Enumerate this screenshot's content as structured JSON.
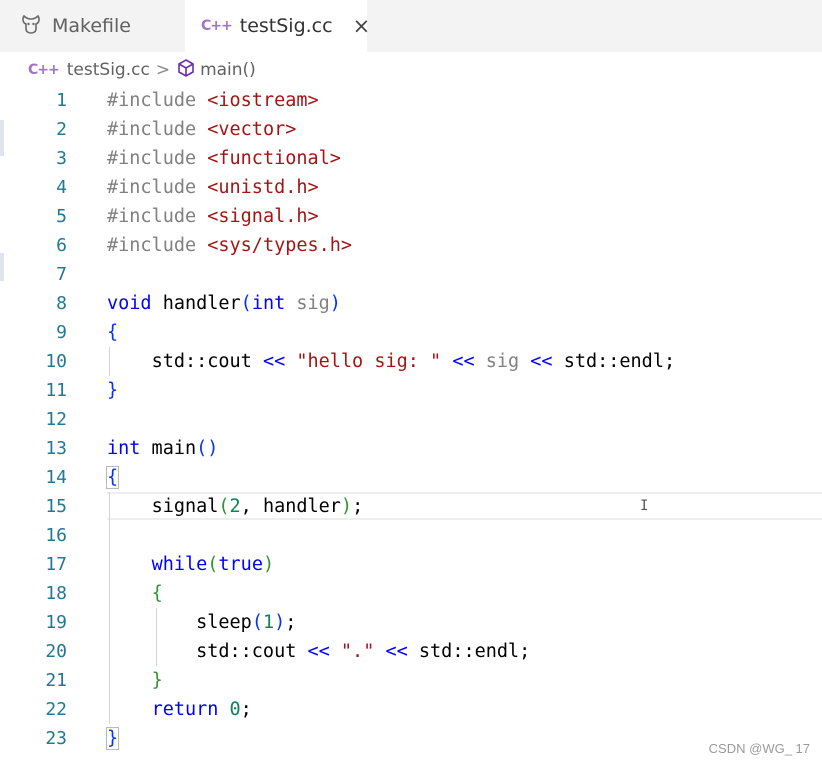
{
  "tabs": [
    {
      "label": "Makefile",
      "icon": "gnu-makefile-icon",
      "active": false
    },
    {
      "label": "testSig.cc",
      "icon": "cpp-file-icon",
      "active": true
    }
  ],
  "tab_icon_text": "C++",
  "close_glyph": "×",
  "breadcrumb": {
    "file": "testSig.cc",
    "separator": ">",
    "symbol": "main()"
  },
  "line_numbers": [
    "1",
    "2",
    "3",
    "4",
    "5",
    "6",
    "7",
    "8",
    "9",
    "10",
    "11",
    "12",
    "13",
    "14",
    "15",
    "16",
    "17",
    "18",
    "19",
    "20",
    "21",
    "22",
    "23"
  ],
  "code": {
    "l1_pre": "#include ",
    "l1_hdr": "<iostream>",
    "l2_pre": "#include ",
    "l2_hdr": "<vector>",
    "l3_pre": "#include ",
    "l3_hdr": "<functional>",
    "l4_pre": "#include ",
    "l4_hdr": "<unistd.h>",
    "l5_pre": "#include ",
    "l5_hdr": "<signal.h>",
    "l6_pre": "#include ",
    "l6_hdr": "<sys/types.h>",
    "l8_void": "void",
    "l8_name": " handler",
    "l8_open": "(",
    "l8_int": "int",
    "l8_param": " sig",
    "l8_close": ")",
    "l9_brace": "{",
    "l10_indent": "    ",
    "l10_a": "std::cout ",
    "l10_op1": "<<",
    "l10_str": " \"hello sig: \" ",
    "l10_op2": "<<",
    "l10_sig": " sig ",
    "l10_op3": "<<",
    "l10_b": " std::endl;",
    "l11_brace": "}",
    "l13_int": "int",
    "l13_name": " main",
    "l13_parens": "()",
    "l14_brace": "{",
    "l15_indent": "    ",
    "l15_a": "signal",
    "l15_open": "(",
    "l15_num": "2",
    "l15_b": ", handler",
    "l15_close": ")",
    "l15_semi": ";",
    "l17_indent": "    ",
    "l17_while": "while",
    "l17_open": "(",
    "l17_true": "true",
    "l17_close": ")",
    "l18_indent": "    ",
    "l18_brace": "{",
    "l19_indent": "        ",
    "l19_a": "sleep",
    "l19_open": "(",
    "l19_num": "1",
    "l19_close": ")",
    "l19_semi": ";",
    "l20_indent": "        ",
    "l20_a": "std::cout ",
    "l20_op1": "<<",
    "l20_str": " \".\" ",
    "l20_op2": "<<",
    "l20_b": " std::endl;",
    "l21_indent": "    ",
    "l21_brace": "}",
    "l22_indent": "    ",
    "l22_return": "return",
    "l22_sp": " ",
    "l22_num": "0",
    "l22_semi": ";",
    "l23_brace": "}"
  },
  "watermark": "CSDN @WG_ 17",
  "colors": {
    "preprocessor": "#808080",
    "header_string": "#a31515",
    "keyword": "#0000ff",
    "line_number": "#237893",
    "number": "#098658",
    "bracket_level1": "#0431fa",
    "bracket_level2": "#319331"
  }
}
